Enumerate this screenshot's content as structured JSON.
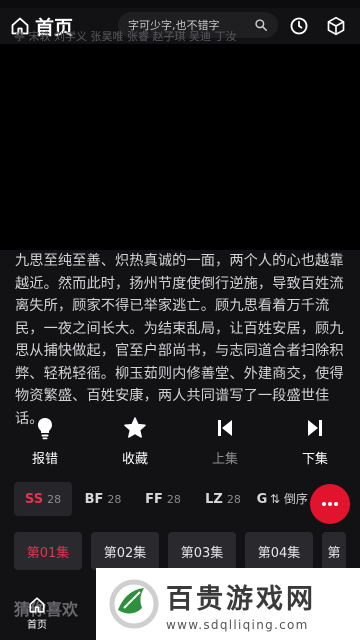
{
  "header": {
    "title": "首页"
  },
  "marquee": {
    "text": "亭 宋轶 刘学义 张昊唯 张睿 赵子琪 吴迪 丁汝"
  },
  "search": {
    "placeholder": "字可少字,也不错字"
  },
  "synopsis": "九思至纯至善、炽热真诚的一面，两个人的心也越靠越近。然而此时，扬州节度使倒行逆施，导致百姓流离失所，顾家不得已举家逃亡。顾九思看着万千流民，一夜之间长大。为结束乱局，让百姓安居，顾九思从捕快做起，官至户部尚书，与志同道合者扫除积弊、轻税轻徭。柳玉茹则内修善堂、外建商交，使得物资繁盛、百姓安康，两人共同谱写了一段盛世佳话。",
  "actions": [
    {
      "label": "报错",
      "icon": "bulb-icon"
    },
    {
      "label": "收藏",
      "icon": "star-icon"
    },
    {
      "label": "上集",
      "icon": "skip-previous-icon"
    },
    {
      "label": "下集",
      "icon": "skip-next-icon"
    }
  ],
  "sources": [
    {
      "code": "SS",
      "count": "28"
    },
    {
      "code": "BF",
      "count": "28"
    },
    {
      "code": "FF",
      "count": "28"
    },
    {
      "code": "LZ",
      "count": "28"
    },
    {
      "code": "G",
      "count": ""
    }
  ],
  "sort_label": "倒序",
  "episodes": [
    "第01集",
    "第02集",
    "第03集",
    "第04集",
    "第"
  ],
  "section_title": "猜你喜欢",
  "bottom_tab": {
    "label": "首页"
  },
  "watermark": {
    "chars": [
      "百",
      "贵",
      "游",
      "戏",
      "网"
    ],
    "url": "www.sdqlliqing.com"
  },
  "colors": {
    "accent": "#e2354e",
    "fab": "#e2142d",
    "background": "#121214"
  }
}
